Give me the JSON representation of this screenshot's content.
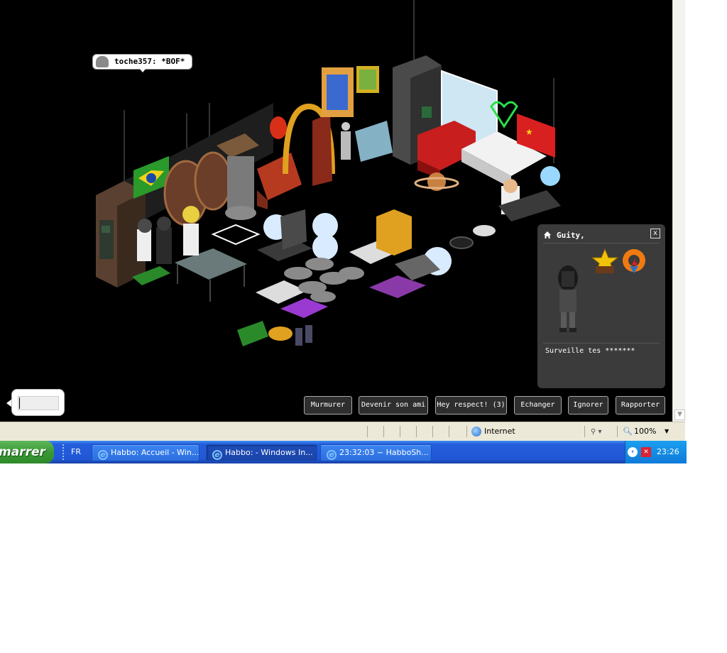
{
  "chat_bubble": {
    "user": "toche357:",
    "message": "*BOF*"
  },
  "profile_card": {
    "name": "Guity,",
    "motto": "Surveille tes *******",
    "close_label": "x"
  },
  "actions": [
    {
      "id": "murmurer",
      "label": "Murmurer"
    },
    {
      "id": "ami",
      "label": "Devenir son ami"
    },
    {
      "id": "respect",
      "label": "Hey respect! (3)"
    },
    {
      "id": "echanger",
      "label": "Echanger"
    },
    {
      "id": "ignorer",
      "label": "Ignorer"
    },
    {
      "id": "rapporter",
      "label": "Rapporter"
    }
  ],
  "statusbar": {
    "zone": "Internet",
    "zoom": "100%"
  },
  "taskbar": {
    "start": "marrer",
    "language": "FR",
    "tasks": [
      {
        "label": "Habbo: Accueil - Win..."
      },
      {
        "label": "Habbo: - Windows In..."
      },
      {
        "label": "23:32:03 ~ HabboSh..."
      }
    ],
    "clock": "23:26"
  },
  "colors": {
    "room_background": "#000000",
    "card_background": "#3b3b3b",
    "taskbar_blue": "#245edb",
    "start_green": "#3a9a35",
    "statusbar": "#ece9d8"
  }
}
